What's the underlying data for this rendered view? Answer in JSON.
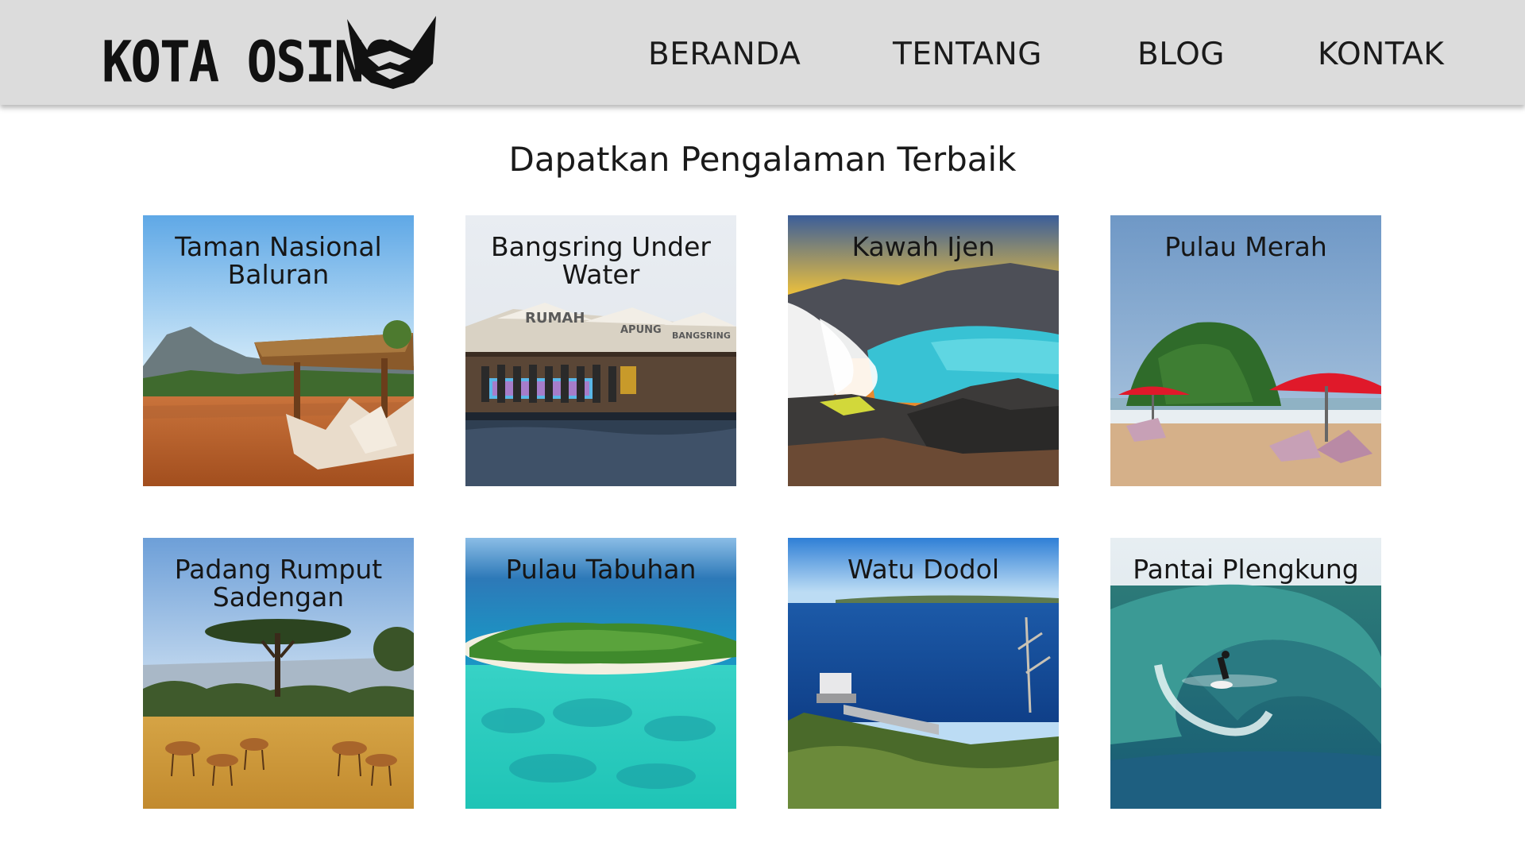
{
  "header": {
    "logo_text": "KOTA OSING",
    "nav": [
      {
        "label": "BERANDA"
      },
      {
        "label": "TENTANG"
      },
      {
        "label": "BLOG"
      },
      {
        "label": "KONTAK"
      }
    ]
  },
  "main": {
    "title": "Dapatkan Pengalaman Terbaik",
    "cards": [
      {
        "label": "Taman Nasional Baluran"
      },
      {
        "label": "Bangsring Under Water"
      },
      {
        "label": "Kawah Ijen"
      },
      {
        "label": "Pulau Merah"
      },
      {
        "label": "Padang Rumput Sadengan"
      },
      {
        "label": "Pulau Tabuhan"
      },
      {
        "label": "Watu Dodol"
      },
      {
        "label": "Pantai Plengkung"
      }
    ],
    "signage": [
      "RUMAH",
      "APUNG",
      "BANGSRING"
    ]
  },
  "colors": {
    "navbar_bg": "#dcdcdc",
    "text": "#1a1a1a"
  }
}
